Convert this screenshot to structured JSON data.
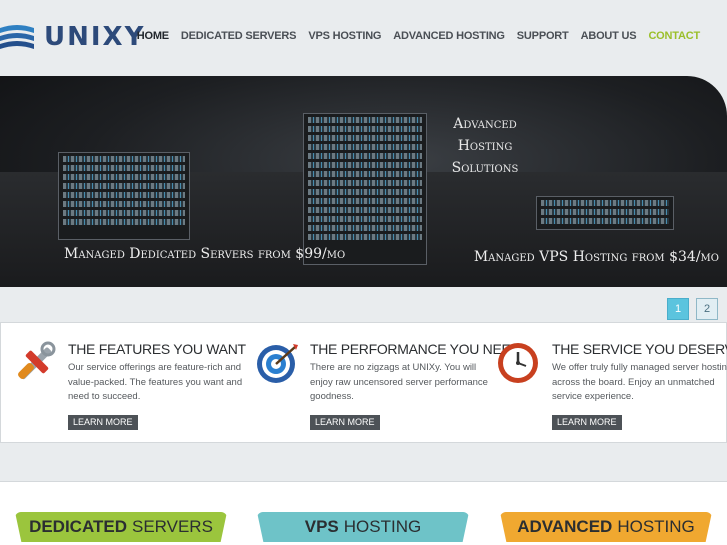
{
  "brand": {
    "name": "UNIXY"
  },
  "nav": [
    {
      "label": "HOME",
      "state": "active"
    },
    {
      "label": "DEDICATED SERVERS"
    },
    {
      "label": "VPS HOSTING"
    },
    {
      "label": "ADVANCED HOSTING"
    },
    {
      "label": "SUPPORT"
    },
    {
      "label": "ABOUT US"
    },
    {
      "label": "CONTACT",
      "color": "#9bbf2a"
    }
  ],
  "hero": {
    "title_line1": "Advanced Hosting",
    "title_line2": "Solutions",
    "left_caption": "Managed Dedicated Servers from $99/mo",
    "right_caption": "Managed VPS Hosting from $34/mo"
  },
  "pager": {
    "pages": [
      "1",
      "2"
    ],
    "current": "1"
  },
  "features": [
    {
      "icon": "tools-icon",
      "title": "THE FEATURES YOU WANT",
      "text": "Our service offerings are feature-rich and value-packed. The features you want and need to succeed.",
      "button": "LEARN MORE"
    },
    {
      "icon": "target-icon",
      "title": "THE PERFORMANCE YOU NEED",
      "text": "There are no zigzags at UNIXy. You will enjoy raw uncensored server performance goodness.",
      "button": "LEARN MORE"
    },
    {
      "icon": "clock-icon",
      "title": "THE SERVICE YOU DESERVE",
      "text": "We offer truly fully managed server hosting across the board. Enjoy an unmatched service experience.",
      "button": "LEARN MORE"
    }
  ],
  "plans": [
    {
      "bold": "DEDICATED",
      "rest": "SERVERS",
      "color": "#9bc53d"
    },
    {
      "bold": "VPS",
      "rest": "HOSTING",
      "color": "#6ec3c8"
    },
    {
      "bold": "ADVANCED",
      "rest": "HOSTING",
      "color": "#f0a830"
    }
  ]
}
